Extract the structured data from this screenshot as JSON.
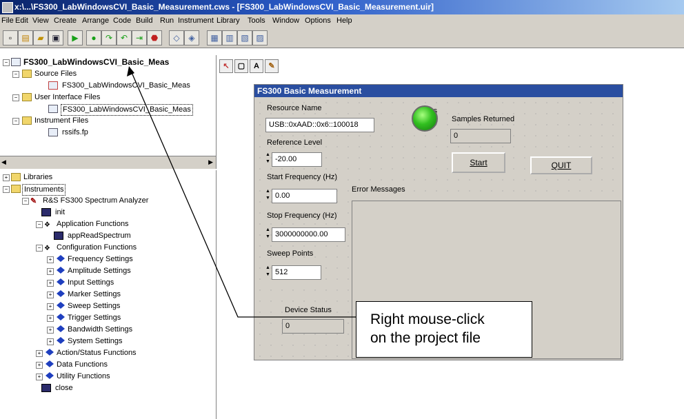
{
  "window": {
    "title": "x:\\...\\FS300_LabWindowsCVI_Basic_Measurement.cws - [FS300_LabWindowsCVI_Basic_Measurement.uir]"
  },
  "menu": [
    "File",
    "Edit",
    "View",
    "Create",
    "Arrange",
    "Code",
    "Build",
    "Run",
    "Instrument",
    "Library",
    "Tools",
    "Window",
    "Options",
    "Help"
  ],
  "project_tree": {
    "root": "FS300_LabWindowsCVI_Basic_Meas",
    "source_files_label": "Source Files",
    "source_file": "FS300_LabWindowsCVI_Basic_Meas",
    "ui_files_label": "User Interface Files",
    "ui_file": "FS300_LabWindowsCVI_Basic_Meas",
    "instrument_files_label": "Instrument Files",
    "instrument_file": "rssifs.fp"
  },
  "library_tree": {
    "libraries": "Libraries",
    "instruments": "Instruments",
    "analyzer": "R&S FS300 Spectrum Analyzer",
    "init": "init",
    "app_functions": "Application Functions",
    "app_read": "appReadSpectrum",
    "config_functions": "Configuration Functions",
    "config_items": [
      "Frequency Settings",
      "Amplitude Settings",
      "Input Settings",
      "Marker Settings",
      "Sweep Settings",
      "Trigger Settings",
      "Bandwidth Settings",
      "System Settings"
    ],
    "action_status": "Action/Status Functions",
    "data_functions": "Data Functions",
    "utility_functions": "Utility Functions",
    "close": "close"
  },
  "panel": {
    "title": "FS300 Basic Measurement",
    "resource_label": "Resource Name",
    "resource_value": "USB::0xAAD::0x6::100018",
    "status_label": "Status",
    "samples_label": "Samples Returned",
    "samples_value": "0",
    "ref_level_label": "Reference Level",
    "ref_level_value": "-20.00",
    "start_button": "Start",
    "quit_button": "QUIT",
    "start_freq_label": "Start Frequency (Hz)",
    "start_freq_value": "0.00",
    "error_messages_label": "Error Messages",
    "stop_freq_label": "Stop Frequency (Hz)",
    "stop_freq_value": "3000000000.00",
    "sweep_points_label": "Sweep Points",
    "sweep_points_value": "512",
    "device_status_label": "Device Status",
    "device_status_value": "0"
  },
  "callout": {
    "line1": "Right mouse-click",
    "line2": "on the project file"
  },
  "colors": {
    "titlebar": "#0a246a",
    "panel_title": "#2a4ea0",
    "led_on": "#32c020"
  }
}
